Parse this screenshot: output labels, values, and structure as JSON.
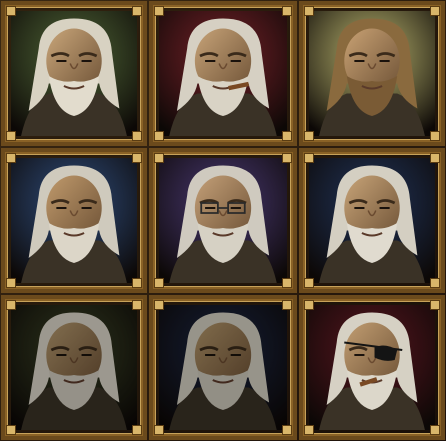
{
  "grid": {
    "tiles": [
      {
        "id": "portrait-1",
        "bg": "#4f6a3a",
        "hair": "#d8d2c2",
        "beard": "#e2dccd",
        "skin": "#c9a67a",
        "icon": "old-man-portrait-icon"
      },
      {
        "id": "portrait-2",
        "bg": "#7a1f2a",
        "hair": "#d6d0c3",
        "beard": "#d9d3c5",
        "skin": "#c7a378",
        "icon": "cigar-man-portrait-icon"
      },
      {
        "id": "portrait-3",
        "bg": "#c9c67a",
        "hair": "#8a6a3e",
        "beard": "#7a5b35",
        "skin": "#c9a274",
        "icon": "brown-hair-man-portrait-icon"
      },
      {
        "id": "portrait-4",
        "bg": "#2c4f86",
        "hair": "#cfcabd",
        "beard": "#dcd6c8",
        "skin": "#c09a6c",
        "icon": "ponytail-man-portrait-icon"
      },
      {
        "id": "portrait-5",
        "bg": "#4a3a7c",
        "hair": "#cfcabf",
        "beard": "#d6d1c4",
        "skin": "#c4a078",
        "icon": "glasses-man-portrait-icon"
      },
      {
        "id": "portrait-6",
        "bg": "#1e3560",
        "hair": "#d4cfc2",
        "beard": "#e0dbcf",
        "skin": "#c8a478",
        "icon": "long-white-hair-man-portrait-icon"
      },
      {
        "id": "portrait-7",
        "bg": "#3e4a2a",
        "hair": "#d8d3c6",
        "beard": "#cfcabd",
        "skin": "#b5996e",
        "icon": "shadowed-man-portrait-icon"
      },
      {
        "id": "portrait-8",
        "bg": "#1c2a4e",
        "hair": "#d2cdc0",
        "beard": "#cbc6b9",
        "skin": "#b3966a",
        "icon": "shadowed-man-2-portrait-icon"
      },
      {
        "id": "portrait-9",
        "bg": "#5a1420",
        "hair": "#d6d1c4",
        "beard": "#dcd7ca",
        "skin": "#c29e72",
        "icon": "eyepatch-man-portrait-icon"
      }
    ]
  }
}
